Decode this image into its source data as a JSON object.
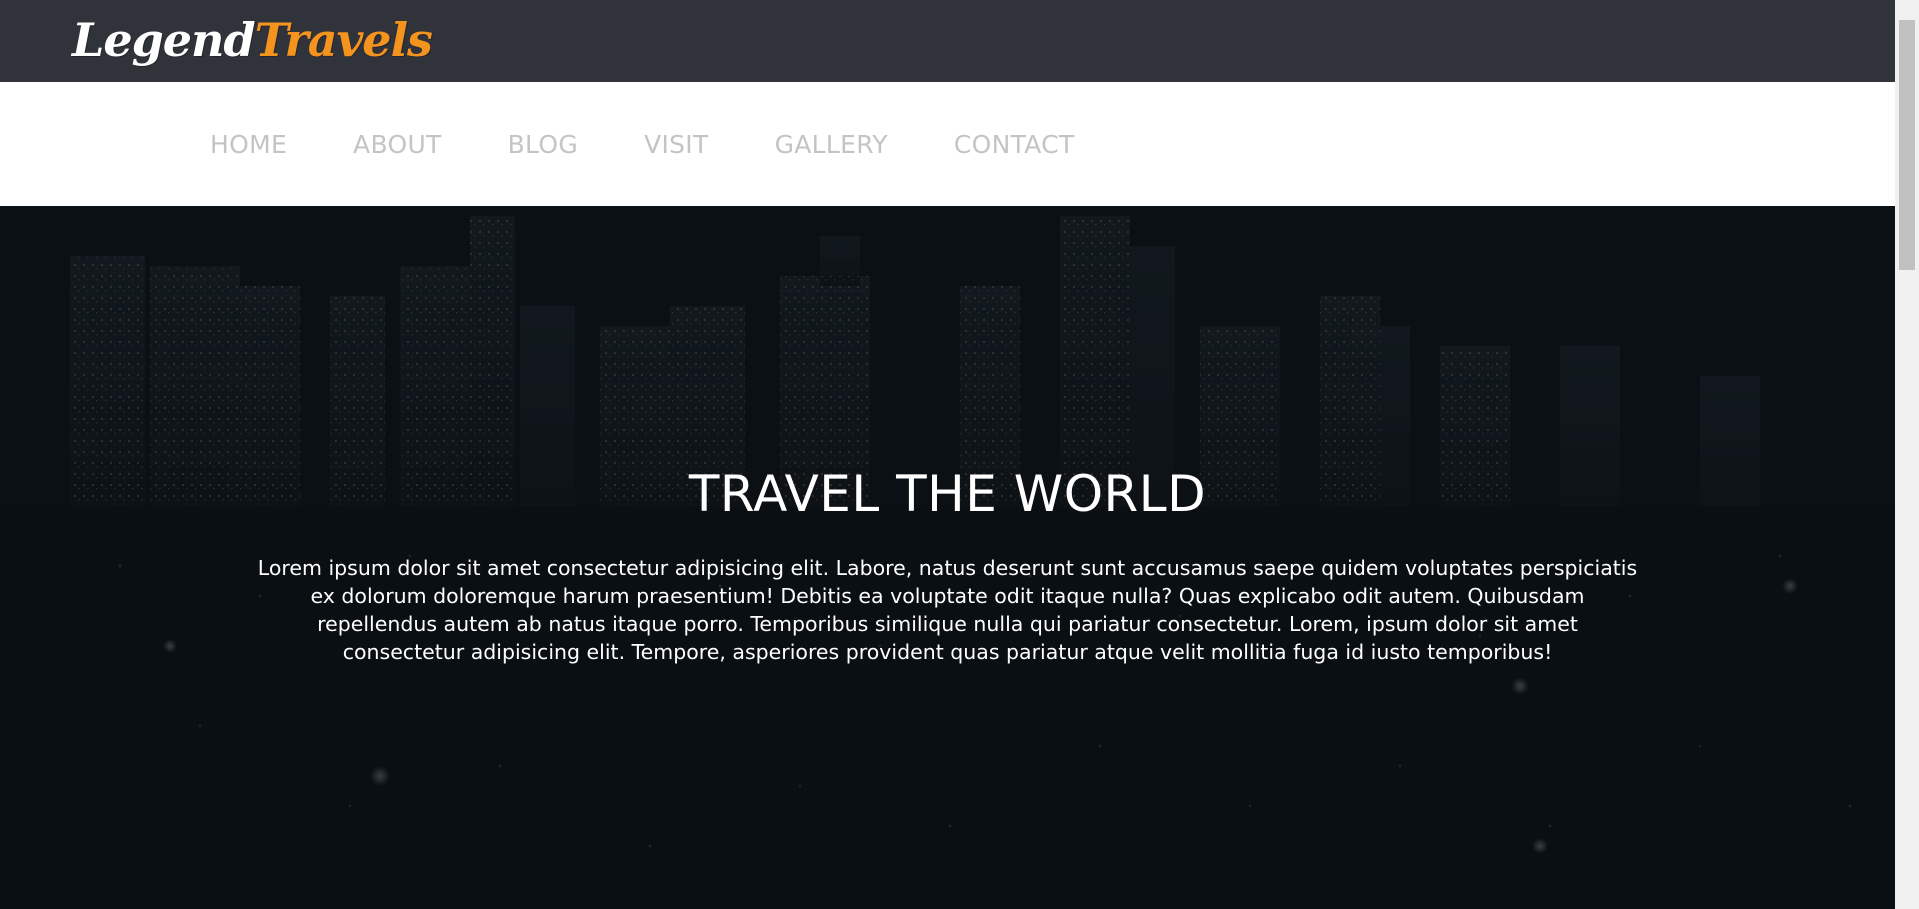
{
  "brand": {
    "word1": "Legend",
    "word2": "Travels",
    "accent_color": "#f5931f"
  },
  "nav": {
    "items": [
      {
        "label": "HOME"
      },
      {
        "label": "ABOUT"
      },
      {
        "label": "BLOG"
      },
      {
        "label": "VISIT"
      },
      {
        "label": "GALLERY"
      },
      {
        "label": "CONTACT"
      }
    ]
  },
  "hero": {
    "title": "TRAVEL THE WORLD",
    "text": "Lorem ipsum dolor sit amet consectetur adipisicing elit. Labore, natus deserunt sunt accusamus saepe quidem voluptates perspiciatis ex dolorum doloremque harum praesentium! Debitis ea voluptate odit itaque nulla? Quas explicabo odit autem. Quibusdam repellendus autem ab natus itaque porro. Temporibus similique nulla qui pariatur consectetur. Lorem, ipsum dolor sit amet consectetur adipisicing elit. Tempore, asperiores provident quas pariatur atque velit mollitia fuga id iusto temporibus!",
    "background": "night-city-skyline-image"
  },
  "colors": {
    "topbar": "#31333b",
    "nav_text": "#c4c4c4"
  }
}
